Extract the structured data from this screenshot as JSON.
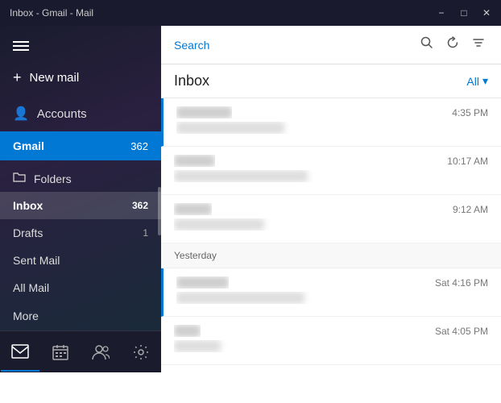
{
  "window": {
    "title": "Inbox - Gmail - Mail",
    "controls": {
      "minimize": "−",
      "maximize": "□",
      "close": "✕"
    }
  },
  "sidebar": {
    "menu_icon": "≡",
    "new_mail_label": "New mail",
    "accounts_label": "Accounts",
    "gmail_label": "Gmail",
    "gmail_badge": "362",
    "folders_label": "Folders",
    "folders_icon": "□",
    "inbox_label": "Inbox",
    "inbox_badge": "362",
    "drafts_label": "Drafts",
    "drafts_badge": "1",
    "sent_label": "Sent Mail",
    "all_mail_label": "All Mail",
    "more_label": "More"
  },
  "bottom_nav": {
    "mail_icon": "✉",
    "calendar_icon": "▦",
    "people_icon": "👤",
    "settings_icon": "⚙"
  },
  "search": {
    "placeholder": "Search",
    "search_icon": "🔍",
    "sync_icon": "↻",
    "filter_icon": "⚌"
  },
  "inbox": {
    "title": "Inbox",
    "filter_label": "All",
    "filter_icon": "▾"
  },
  "emails": {
    "today": [
      {
        "sender": "██████████ ████",
        "subject": "██ ██████, ████████ ██████",
        "time": "4:35 PM",
        "unread": true
      },
      {
        "sender": "████████████",
        "subject": "████████████████████████████████████",
        "time": "10:17 AM",
        "unread": false
      },
      {
        "sender": "█████████ ███",
        "subject": "████████████████████████████",
        "time": "9:12 AM",
        "unread": false
      }
    ],
    "yesterday_label": "Yesterday",
    "yesterday": [
      {
        "sender": "████████████████",
        "subject": "████████████████████████████████████",
        "time": "Sat 4:16 PM",
        "unread": true
      },
      {
        "sender": "██████",
        "subject": "████████████████",
        "time": "Sat 4:05 PM",
        "unread": false
      }
    ]
  }
}
